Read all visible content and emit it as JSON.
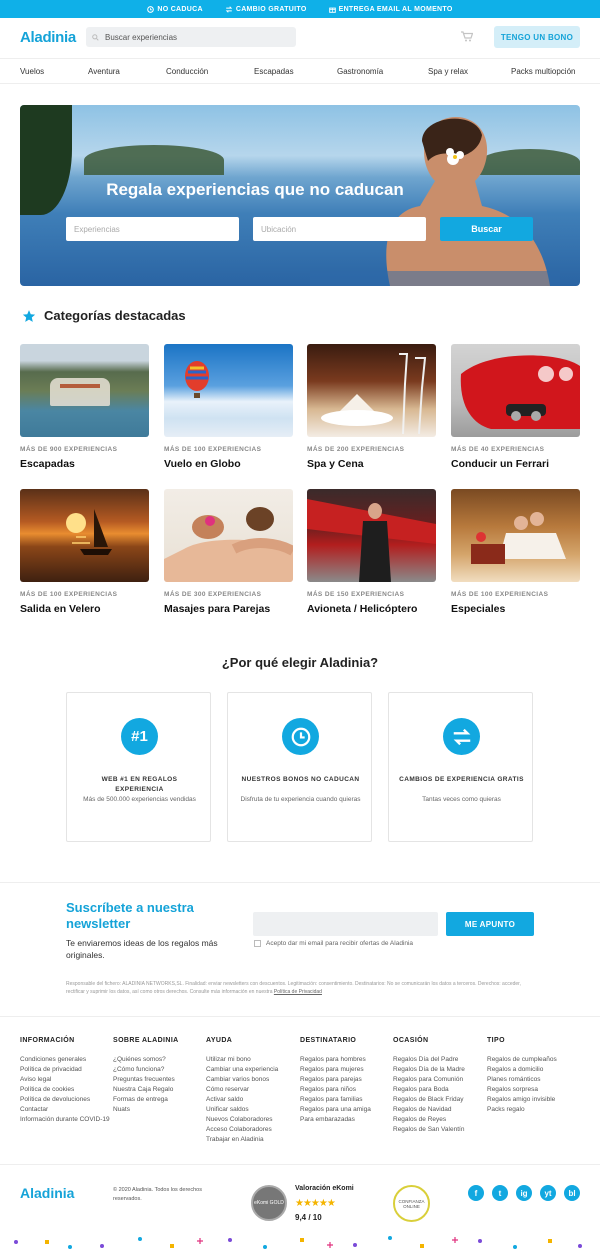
{
  "topbar": {
    "items": [
      "NO CADUCA",
      "CAMBIO GRATUITO",
      "ENTREGA EMAIL AL MOMENTO"
    ]
  },
  "header": {
    "logo": "Aladinia",
    "search_placeholder": "Buscar experiencias",
    "cta": "TENGO UN BONO"
  },
  "nav": [
    "Vuelos",
    "Aventura",
    "Conducción",
    "Escapadas",
    "Gastronomía",
    "Spa y relax",
    "Packs multiopción"
  ],
  "hero": {
    "title": "Regala experiencias que no caducan",
    "exp_placeholder": "Experiencias",
    "loc_placeholder": "Ubicación",
    "button": "Buscar"
  },
  "categories": {
    "title": "Categorías destacadas",
    "items": [
      {
        "count": "MÁS DE 900 EXPERIENCIAS",
        "name": "Escapadas"
      },
      {
        "count": "MÁS DE 100 EXPERIENCIAS",
        "name": "Vuelo en Globo"
      },
      {
        "count": "MÁS DE 200 EXPERIENCIAS",
        "name": "Spa y Cena"
      },
      {
        "count": "MÁS DE 40 EXPERIENCIAS",
        "name": "Conducir un Ferrari"
      },
      {
        "count": "MÁS DE 100 EXPERIENCIAS",
        "name": "Salida en Velero"
      },
      {
        "count": "MÁS DE 300 EXPERIENCIAS",
        "name": "Masajes para Parejas"
      },
      {
        "count": "MÁS DE 150 EXPERIENCIAS",
        "name": "Avioneta / Helicóptero"
      },
      {
        "count": "MÁS DE 100 EXPERIENCIAS",
        "name": "Especiales"
      }
    ]
  },
  "why": {
    "title": "¿Por qué elegir Aladinia?",
    "boxes": [
      {
        "icon": "#1",
        "title": "WEB #1 EN REGALOS EXPERIENCIA",
        "text": "Más de 500.000 experiencias vendidas"
      },
      {
        "icon": "",
        "title": "NUESTROS BONOS NO CADUCAN",
        "text": "Disfruta de tu experiencia cuando quieras"
      },
      {
        "icon": "",
        "title": "CAMBIOS DE EXPERIENCIA GRATIS",
        "text": "Tantas veces como quieras"
      }
    ]
  },
  "newsletter": {
    "title": "Suscríbete a nuestra newsletter",
    "text": "Te enviaremos ideas de los regalos más originales.",
    "button": "ME APUNTO",
    "checkbox": "Acepto dar mi email para recibir ofertas de Aladinia",
    "legal": "Responsable del fichero: ALADINIA NETWORKS,SL. Finalidad: enviar newsletters con descuentos. Legitimación: consentimiento. Destinatarios: No se comunicarán los datos a terceros. Derechos: acceder, rectificar y suprimir los datos, así como otros derechos. Consulte más información en nuestra ",
    "legal_link": "Política de Privacidad"
  },
  "footer": {
    "columns": [
      {
        "title": "INFORMACIÓN",
        "links": [
          "Condiciones generales",
          "Política de privacidad",
          "Aviso legal",
          "Política de cookies",
          "Política de devoluciones",
          "Contactar",
          "Información durante COVID-19"
        ]
      },
      {
        "title": "SOBRE ALADINIA",
        "links": [
          "¿Quiénes somos?",
          "¿Cómo funciona?",
          "Preguntas frecuentes",
          "Nuestra Caja Regalo",
          "Formas de entrega",
          "Nuats"
        ]
      },
      {
        "title": "AYUDA",
        "links": [
          "Utilizar mi bono",
          "Cambiar una experiencia",
          "Cambiar varios bonos",
          "Cómo reservar",
          "Activar saldo",
          "Unificar saldos",
          "Nuevos Colaboradores",
          "Acceso Colaboradores",
          "Trabajar en Aladinia"
        ]
      },
      {
        "title": "DESTINATARIO",
        "links": [
          "Regalos para hombres",
          "Regalos para mujeres",
          "Regalos para parejas",
          "Regalos para niños",
          "Regalos para familias",
          "Regalos para una amiga",
          "Para embarazadas"
        ]
      },
      {
        "title": "OCASIÓN",
        "links": [
          "Regalos Día del Padre",
          "Regalos Día de la Madre",
          "Regalos para Comunión",
          "Regalos para Boda",
          "Regalos de Black Friday",
          "Regalos de Navidad",
          "Regalos de Reyes",
          "Regalos de San Valentín"
        ]
      },
      {
        "title": "TIPO",
        "links": [
          "Regalos de cumpleaños",
          "Regalos a domicilio",
          "Planes románticos",
          "Regalos sorpresa",
          "Regalos amigo invisible",
          "Packs regalo"
        ]
      }
    ],
    "logo": "Aladinia",
    "copyright": "© 2020 Aladinia. Todos los derechos reservados.",
    "ekomi_title": "Valoración eKomi",
    "ekomi_stars": "★★★★★",
    "ekomi_score": "9,4 / 10",
    "ekomi_badge": "eKomi GOLD",
    "confianza": "CONFIANZA ONLINE",
    "social": [
      "f",
      "t",
      "ig",
      "yt",
      "bl"
    ]
  },
  "colors": {
    "brand": "#12a8e0",
    "topbar": "#0fb0e8",
    "stars": "#f4b400"
  }
}
